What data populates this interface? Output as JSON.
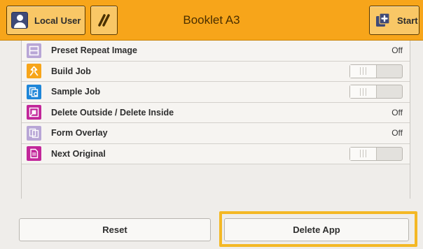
{
  "header": {
    "user_label": "Local User",
    "title": "Booklet A3",
    "start_label": "Start"
  },
  "list": {
    "items": [
      {
        "label": "Preset Repeat Image",
        "value": "Off",
        "icon": "preset-repeat-image-icon",
        "icon_color": "#b8a6d6"
      },
      {
        "label": "Build Job",
        "value": "",
        "control": "toggle",
        "state": "off",
        "icon": "build-job-icon",
        "icon_color": "#f7a51a"
      },
      {
        "label": "Sample Job",
        "value": "",
        "control": "toggle",
        "state": "off",
        "icon": "sample-job-icon",
        "icon_color": "#1f86d8"
      },
      {
        "label": "Delete Outside / Delete Inside",
        "value": "Off",
        "icon": "delete-outside-icon",
        "icon_color": "#c2279a"
      },
      {
        "label": "Form Overlay",
        "value": "Off",
        "icon": "form-overlay-icon",
        "icon_color": "#b8a6d6"
      },
      {
        "label": "Next Original",
        "value": "",
        "control": "toggle",
        "state": "off",
        "icon": "next-original-icon",
        "icon_color": "#c2279a"
      }
    ]
  },
  "footer": {
    "reset_label": "Reset",
    "delete_label": "Delete App"
  },
  "colors": {
    "header": "#f7a51a",
    "highlight": "#f4b825"
  }
}
